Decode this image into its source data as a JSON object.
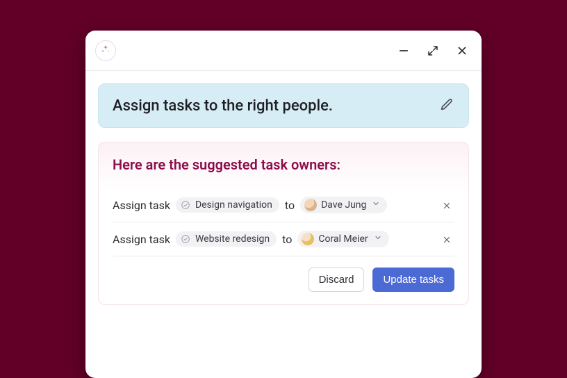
{
  "icons": {
    "logo": "sparkle-icon",
    "minimize": "minimize-icon",
    "expand": "expand-icon",
    "close": "close-icon",
    "edit": "pencil-icon",
    "task": "check-circle-icon",
    "chevron": "chevron-down-icon",
    "remove": "x-icon"
  },
  "prompt": {
    "text": "Assign tasks to the right people."
  },
  "result": {
    "heading": "Here are the suggested task owners:",
    "assign_prefix": "Assign task",
    "to_label": "to",
    "rows": [
      {
        "task": "Design navigation",
        "assignee": "Dave Jung"
      },
      {
        "task": "Website redesign",
        "assignee": "Coral Meier"
      }
    ]
  },
  "actions": {
    "discard": "Discard",
    "update": "Update tasks"
  }
}
